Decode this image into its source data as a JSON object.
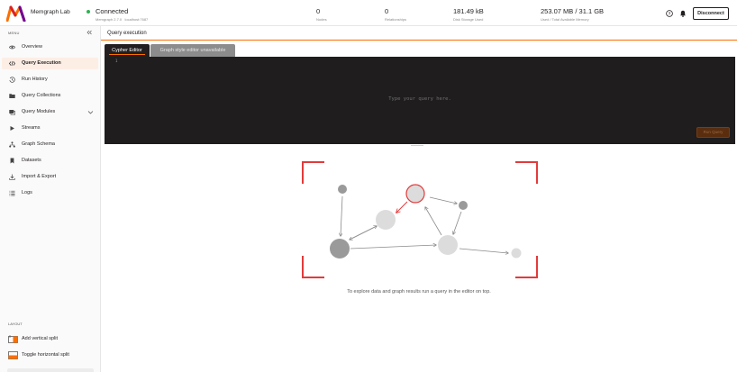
{
  "header": {
    "app_title": "Memgraph Lab",
    "connection": {
      "status": "Connected",
      "version": "Memgraph 2.7.0",
      "host": "localhost:7687",
      "status_color": "#32b052"
    },
    "stats": [
      {
        "value": "0",
        "label": "Nodes"
      },
      {
        "value": "0",
        "label": "Relationships"
      },
      {
        "value": "181.49 kB",
        "label": "Disk Storage Used"
      },
      {
        "value": "253.07 MB / 31.1 GB",
        "label": "Used / Total Available Memory"
      }
    ],
    "disconnect_label": "Disconnect"
  },
  "sidebar": {
    "menu_label": "MENU",
    "items": [
      {
        "label": "Overview",
        "icon": "eye-icon"
      },
      {
        "label": "Query Execution",
        "icon": "code-icon",
        "active": true
      },
      {
        "label": "Run History",
        "icon": "history-icon"
      },
      {
        "label": "Query Collections",
        "icon": "folder-icon"
      },
      {
        "label": "Query Modules",
        "icon": "modules-icon"
      },
      {
        "label": "Streams",
        "icon": "play-icon"
      },
      {
        "label": "Graph Schema",
        "icon": "schema-icon"
      },
      {
        "label": "Datasets",
        "icon": "bookmark-icon"
      },
      {
        "label": "Import & Export",
        "icon": "download-icon"
      },
      {
        "label": "Logs",
        "icon": "list-icon"
      }
    ],
    "layout_label": "LAYOUT",
    "layout_items": [
      {
        "label": "Add vertical split",
        "icon": "vertical-split-icon"
      },
      {
        "label": "Toggle horizontal split",
        "icon": "horizontal-split-icon"
      }
    ]
  },
  "main": {
    "title": "Query execution",
    "tabs": [
      {
        "label": "Cypher Editor",
        "active": true
      },
      {
        "label": "Graph style editor unavailable",
        "active": false
      }
    ],
    "editor": {
      "line_number": "1",
      "placeholder": "Type your query here.",
      "run_label": "Run Query"
    },
    "empty_state": "To explore data and graph results run a query in the editor on top."
  },
  "colors": {
    "accent": "#fb6e00",
    "editor_bg": "#1f1d1e",
    "frame_red": "#e23b3b"
  }
}
